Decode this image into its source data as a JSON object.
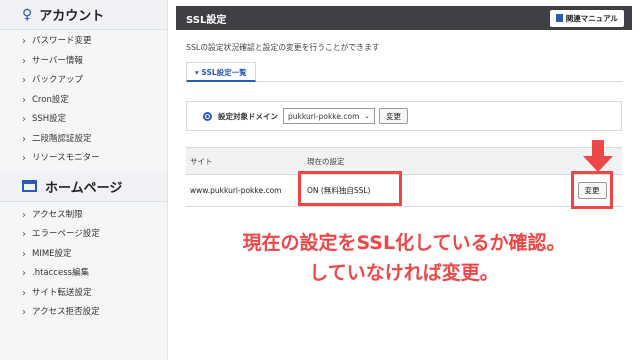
{
  "sidebar": {
    "account_header": "アカウント",
    "account_items": [
      "パスワード変更",
      "サーバー情報",
      "バックアップ",
      "Cron設定",
      "SSH設定",
      "二段階認証設定",
      "リソースモニター"
    ],
    "home_header": "ホームページ",
    "home_items": [
      "アクセス制限",
      "エラーページ設定",
      "MIME設定",
      ".htaccess編集",
      "サイト転送設定",
      "アクセス拒否設定"
    ]
  },
  "header": {
    "title": "SSL設定",
    "manual_label": "関連マニュアル"
  },
  "main": {
    "description": "SSLの設定状況確認と設定の変更を行うことができます",
    "tab_label": "SSL設定一覧",
    "domain_label": "設定対象ドメイン",
    "domain_value": "pukkuri-pokke.com",
    "domain_change_button": "変更",
    "table": {
      "columns": [
        "サイト",
        "現在の設定",
        ""
      ],
      "rows": [
        {
          "site": "www.pukkuri-pokke.com",
          "setting": "ON (無料独自SSL)",
          "action": "変更"
        }
      ]
    }
  },
  "annotation": {
    "line1": "現在の設定をSSL化しているか確認。",
    "line2": "していなければ変更。",
    "color": "#ee4747"
  }
}
